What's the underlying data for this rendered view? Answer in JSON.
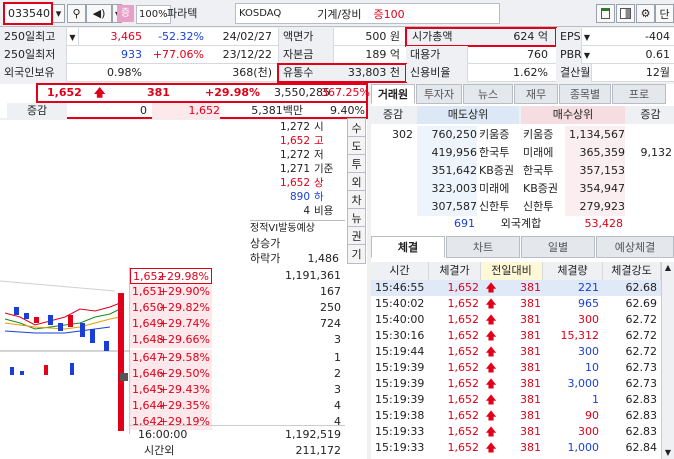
{
  "toolbar": {
    "code": "033540",
    "category_badge": "증",
    "margin": "100%",
    "name": "파라텍",
    "market": "KOSDAQ",
    "sector": "기계/장비",
    "deposit": "증100",
    "unit_button": "단"
  },
  "info": {
    "rows": [
      {
        "l1": "250일최고",
        "v1": "3,465",
        "p1": "-52.32%",
        "d1": "24/02/27",
        "l2": "액면가",
        "v2": "500 원",
        "l3": "시가총액",
        "v3": "624 억",
        "l4": "EPS",
        "v4": "-404"
      },
      {
        "l1": "250일최저",
        "v1": "933",
        "p1": "+77.06%",
        "d1": "23/12/22",
        "l2": "자본금",
        "v2": "189 억",
        "l3": "대용가",
        "v3": "760",
        "l4": "PBR",
        "v4": "0.61"
      },
      {
        "l1": "외국인보유",
        "v1": "0.98%",
        "p1": "",
        "d1": "368(천)",
        "l2": "유통수",
        "v2": "33,803 천",
        "l3": "신용비율",
        "v3": "1.62%",
        "l4": "결산월",
        "v4": "12월"
      }
    ]
  },
  "price": {
    "current": "1,652",
    "change": "381",
    "rate": "+29.98%",
    "volume": "3,550,285",
    "volume_rate": "367.25%",
    "increase_label": "증감",
    "increase_val": "0",
    "increase_price": "1,652",
    "amount": "5,381백만",
    "amount_rate": "9.40%"
  },
  "summary": [
    {
      "v": "1,272",
      "l": "시"
    },
    {
      "v": "1,652",
      "l": "고"
    },
    {
      "v": "1,272",
      "l": "저"
    },
    {
      "v": "1,271",
      "l": "기준"
    },
    {
      "v": "1,652",
      "l": "상"
    },
    {
      "v": "890",
      "l": "하"
    },
    {
      "v": "4",
      "l": "비용"
    }
  ],
  "vi": {
    "title": "정적VI발동예상",
    "upper": "상승가",
    "lower": "하락가",
    "lower_val": "1,486"
  },
  "side_buttons": [
    "수",
    "도",
    "투",
    "외",
    "차",
    "뉴",
    "권",
    "기"
  ],
  "bids": [
    {
      "price": "1,652",
      "rate": "+29.98%",
      "qty": "1,191,361"
    },
    {
      "price": "1,651",
      "rate": "+29.90%",
      "qty": "167"
    },
    {
      "price": "1,650",
      "rate": "+29.82%",
      "qty": "250"
    },
    {
      "price": "1,649",
      "rate": "+29.74%",
      "qty": "724"
    },
    {
      "price": "1,648",
      "rate": "+29.66%",
      "qty": "3"
    },
    {
      "price": "1,647",
      "rate": "+29.58%",
      "qty": "1"
    },
    {
      "price": "1,646",
      "rate": "+29.50%",
      "qty": "2"
    },
    {
      "price": "1,645",
      "rate": "+29.43%",
      "qty": "3"
    },
    {
      "price": "1,644",
      "rate": "+29.35%",
      "qty": "4"
    },
    {
      "price": "1,642",
      "rate": "+29.19%",
      "qty": "4"
    }
  ],
  "footer": {
    "time": "16:00:00",
    "total": "1,192,519",
    "after_label": "시간외",
    "after_val": "211,172"
  },
  "broker_tabs": [
    "거래원",
    "투자자",
    "뉴스",
    "재무",
    "종목별",
    "프로"
  ],
  "broker_head": {
    "inc": "증감",
    "sell": "매도상위",
    "buy": "매수상위",
    "inc2": "증감"
  },
  "broker_rows": [
    {
      "inc": "302",
      "sq": "760,250",
      "sn": "키움증",
      "bn": "키움증",
      "bq": "1,134,567",
      "inc2": ""
    },
    {
      "inc": "",
      "sq": "419,956",
      "sn": "한국투",
      "bn": "미래에",
      "bq": "365,359",
      "inc2": "9,132"
    },
    {
      "inc": "",
      "sq": "351,642",
      "sn": "KB증권",
      "bn": "한국투",
      "bq": "357,153",
      "inc2": ""
    },
    {
      "inc": "",
      "sq": "323,003",
      "sn": "미래에",
      "bn": "KB증권",
      "bq": "354,947",
      "inc2": ""
    },
    {
      "inc": "",
      "sq": "307,587",
      "sn": "신한투",
      "bn": "신한투",
      "bq": "279,923",
      "inc2": ""
    }
  ],
  "broker_foreign": {
    "sell": "691",
    "label": "외국계합",
    "buy": "53,428"
  },
  "trade_tabs": [
    "체결",
    "차트",
    "일별",
    "예상체결"
  ],
  "trade_head": [
    "시간",
    "체결가",
    "전일대비",
    "체결량",
    "체결강도"
  ],
  "trades": [
    {
      "t": "15:46:55",
      "p": "1,652",
      "d": "381",
      "q": "221",
      "s": "62.68",
      "qc": "blue"
    },
    {
      "t": "15:40:02",
      "p": "1,652",
      "d": "381",
      "q": "965",
      "s": "62.69",
      "qc": "blue"
    },
    {
      "t": "15:40:00",
      "p": "1,652",
      "d": "381",
      "q": "300",
      "s": "62.72",
      "qc": "red"
    },
    {
      "t": "15:30:16",
      "p": "1,652",
      "d": "381",
      "q": "15,312",
      "s": "62.72",
      "qc": "red"
    },
    {
      "t": "15:19:44",
      "p": "1,652",
      "d": "381",
      "q": "300",
      "s": "62.72",
      "qc": "blue"
    },
    {
      "t": "15:19:39",
      "p": "1,652",
      "d": "381",
      "q": "10",
      "s": "62.73",
      "qc": "blue"
    },
    {
      "t": "15:19:39",
      "p": "1,652",
      "d": "381",
      "q": "3,000",
      "s": "62.73",
      "qc": "blue"
    },
    {
      "t": "15:19:39",
      "p": "1,652",
      "d": "381",
      "q": "1",
      "s": "62.83",
      "qc": "blue"
    },
    {
      "t": "15:19:38",
      "p": "1,652",
      "d": "381",
      "q": "90",
      "s": "62.83",
      "qc": "red"
    },
    {
      "t": "15:19:33",
      "p": "1,652",
      "d": "381",
      "q": "300",
      "s": "62.83",
      "qc": "red"
    },
    {
      "t": "15:19:33",
      "p": "1,652",
      "d": "381",
      "q": "1,000",
      "s": "62.84",
      "qc": "blue"
    }
  ],
  "colors": {
    "up": "#e0001a",
    "down": "#1a3fd6",
    "highlight": "#e0001a"
  }
}
